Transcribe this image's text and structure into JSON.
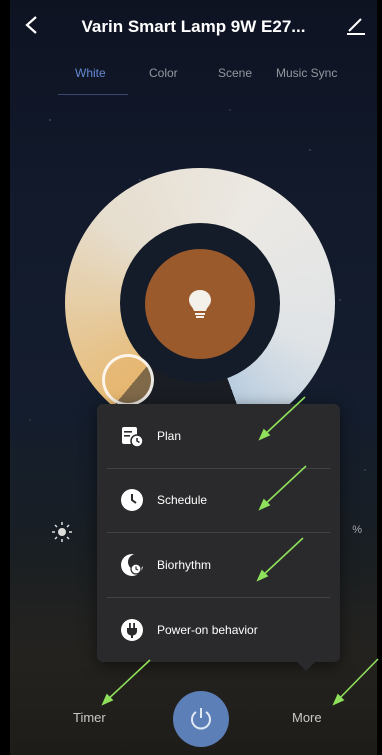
{
  "header": {
    "back_label": "<",
    "title": "Varin Smart Lamp 9W E27..."
  },
  "tabs": [
    {
      "label": "White",
      "active": true
    },
    {
      "label": "Color",
      "active": false
    },
    {
      "label": "Scene",
      "active": false
    },
    {
      "label": "Music Sync",
      "active": false
    }
  ],
  "brightness": {
    "percent_fragment": "%"
  },
  "menu": {
    "items": [
      {
        "label": "Plan",
        "icon": "calendar-clock-icon"
      },
      {
        "label": "Schedule",
        "icon": "clock-icon"
      },
      {
        "label": "Biorhythm",
        "icon": "moon-clock-icon"
      },
      {
        "label": "Power-on behavior",
        "icon": "plug-icon"
      }
    ]
  },
  "bottom": {
    "timer_label": "Timer",
    "more_label": "More"
  },
  "colors": {
    "accent": "#5b7fb6",
    "annotation_arrow": "#8fe05a",
    "popup_bg": "#2a2a2c",
    "center_disc": "#9a5a2b"
  }
}
